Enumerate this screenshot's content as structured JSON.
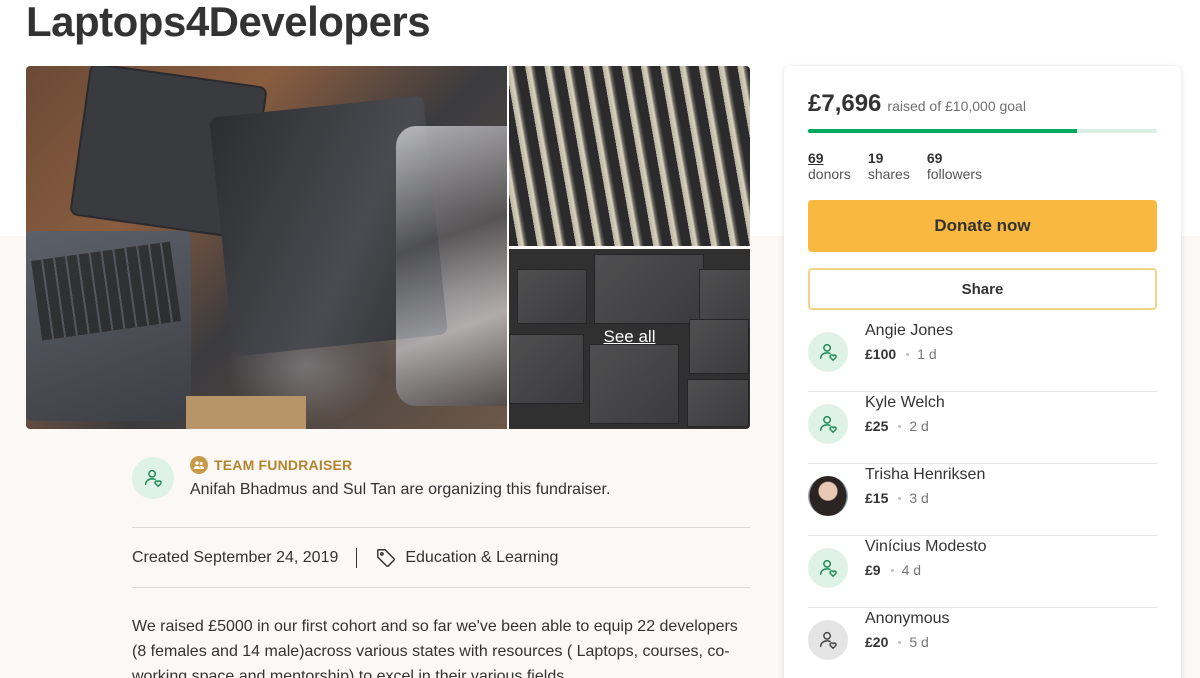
{
  "page": {
    "title": "Laptops4Developers"
  },
  "gallery": {
    "see_all": "See all"
  },
  "organizer": {
    "label": "TEAM FUNDRAISER",
    "text": "Anifah Bhadmus and Sul Tan are organizing this fundraiser."
  },
  "meta": {
    "created": "Created September 24, 2019",
    "category": "Education & Learning"
  },
  "story": {
    "text": "We raised £5000 in our first cohort and so far we've been able to equip 22 developers (8 females and 14 male)across various states with resources ( Laptops, courses, co-working space and mentorship) to excel in their various fields."
  },
  "sidebar": {
    "raised_amount": "£7,696",
    "raised_goal": "raised of £10,000 goal",
    "progress_fraction": 0.7696,
    "stats": [
      {
        "num": "69",
        "label": "donors"
      },
      {
        "num": "19",
        "label": "shares"
      },
      {
        "num": "69",
        "label": "followers"
      }
    ],
    "donate_label": "Donate now",
    "share_label": "Share",
    "donations": [
      {
        "name": "Angie Jones",
        "amount": "£100",
        "time": "1 d",
        "avatar": "default"
      },
      {
        "name": "Kyle Welch",
        "amount": "£25",
        "time": "2 d",
        "avatar": "default"
      },
      {
        "name": "Trisha Henriksen",
        "amount": "£15",
        "time": "3 d",
        "avatar": "photo"
      },
      {
        "name": "Vinícius Modesto",
        "amount": "£9",
        "time": "4 d",
        "avatar": "default"
      },
      {
        "name": "Anonymous",
        "amount": "£20",
        "time": "5 d",
        "avatar": "anonymous"
      }
    ]
  },
  "colors": {
    "accent_green": "#02a95c",
    "donate_yellow": "#f9b941",
    "team_gold": "#b5822e"
  },
  "icons": {
    "organizer_avatar": "user-heart-icon",
    "team": "team-icon",
    "category": "tag-icon"
  }
}
